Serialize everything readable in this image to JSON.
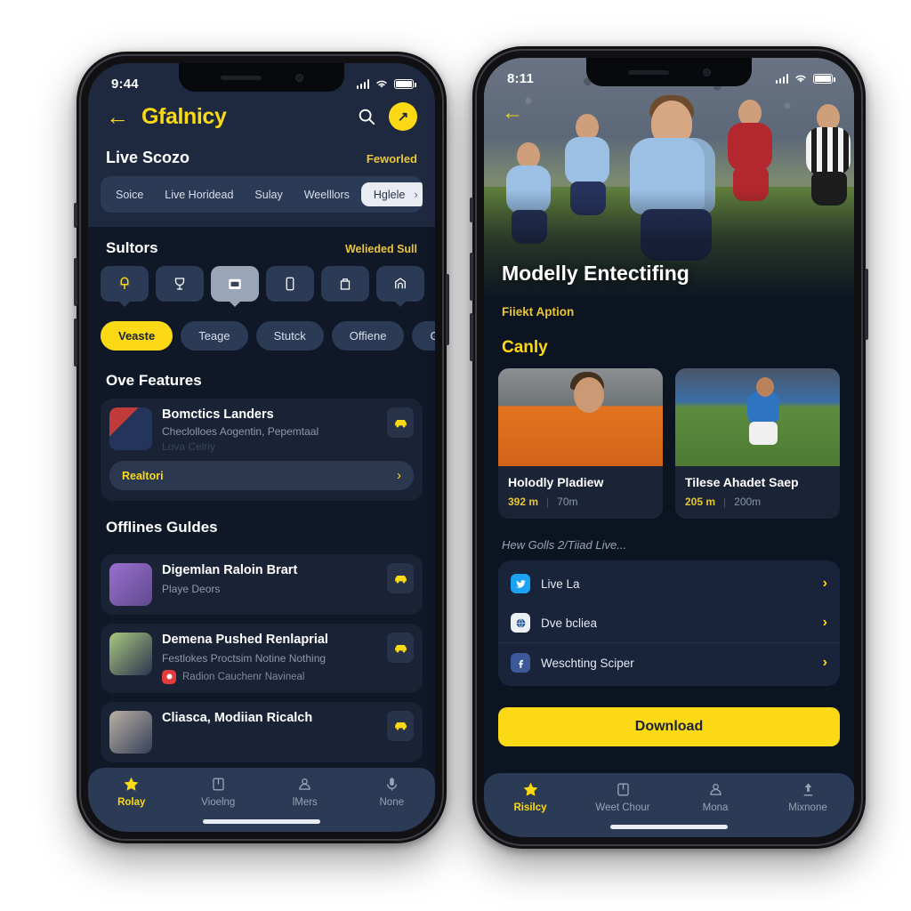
{
  "left_phone": {
    "status_bar": {
      "time": "9:44",
      "signal_icon": "cellular-bars-icon",
      "wifi_icon": "wifi-icon",
      "battery_icon": "battery-icon"
    },
    "header": {
      "back_icon": "back-arrow-icon",
      "brand": "Gfalnicy",
      "search_icon": "search-icon",
      "avatar_label": "↗"
    },
    "subhead": {
      "title": "Live Scozo",
      "action": "Feworled"
    },
    "tabs": [
      {
        "label": "Soice",
        "active": false
      },
      {
        "label": "Live Horidead",
        "active": false
      },
      {
        "label": "Sulay",
        "active": false
      },
      {
        "label": "Weelllors",
        "active": false
      },
      {
        "label": "Hglele",
        "active": true,
        "chevron": "›"
      }
    ],
    "sports_section": {
      "title": "Sultors",
      "action": "Welieded Sull",
      "icons": [
        {
          "name": "bell-icon",
          "active": true,
          "light": false,
          "pointer": true
        },
        {
          "name": "trophy-icon",
          "active": false,
          "light": false,
          "pointer": false
        },
        {
          "name": "calendar-icon",
          "active": true,
          "light": true,
          "pointer": true
        },
        {
          "name": "phone-icon",
          "active": false,
          "light": false,
          "pointer": false
        },
        {
          "name": "bag-icon",
          "active": false,
          "light": false,
          "pointer": false
        },
        {
          "name": "arch-icon",
          "active": false,
          "light": false,
          "pointer": true
        }
      ]
    },
    "chips": [
      {
        "label": "Veaste",
        "active": true
      },
      {
        "label": "Teage",
        "active": false
      },
      {
        "label": "Stutck",
        "active": false
      },
      {
        "label": "Offiene",
        "active": false
      },
      {
        "label": "Giane",
        "active": false
      }
    ],
    "features": {
      "title": "Ove Features",
      "card": {
        "name": "Bomctics Landers",
        "sub": "Checlolloes Aogentin, Pepemtaal",
        "sub2": "Lova Celriy",
        "badge_icon": "car-icon",
        "pill_label": "Realtori",
        "pill_chevron": "›"
      }
    },
    "guides": {
      "title": "Offlines Guldes",
      "items": [
        {
          "name": "Digemlan Raloin Brart",
          "sub": "Playe Deors",
          "meta": "",
          "has_meta_icon": false,
          "badge_icon": "car-icon"
        },
        {
          "name": "Demena Pushed Renlaprial",
          "sub": "Festlokes Proctsim Notine Nothing",
          "meta": "Radion Cauchenr Navineal",
          "has_meta_icon": true,
          "badge_icon": "car-icon"
        },
        {
          "name": "Cliasca, Modiian Ricalch",
          "sub": "",
          "meta": "",
          "has_meta_icon": false,
          "badge_icon": "car-icon"
        }
      ]
    },
    "bottom_nav": [
      {
        "label": "Rolay",
        "icon": "star-icon",
        "active": true
      },
      {
        "label": "Vioelng",
        "icon": "book-icon",
        "active": false
      },
      {
        "label": "lMers",
        "icon": "person-icon",
        "active": false
      },
      {
        "label": "None",
        "icon": "mic-icon",
        "active": false
      }
    ]
  },
  "right_phone": {
    "status_bar": {
      "time": "8:11",
      "signal_icon": "cellular-bars-icon",
      "wifi_icon": "wifi-icon",
      "battery_icon": "battery-icon"
    },
    "hero": {
      "back_icon": "back-arrow-icon",
      "title": "Modelly Entectifing",
      "image_alt": "soccer-match-photo"
    },
    "subtitle": "Fiiekt Aption",
    "section_title": "Canly",
    "match_cards": [
      {
        "title": "Holodly Pladiew",
        "stat1": "392 m",
        "divider": "|",
        "stat2": "70m",
        "image_alt": "orange-kit-player-photo"
      },
      {
        "title": "Tilese Ahadet Saep",
        "stat1": "205 m",
        "divider": "|",
        "stat2": "200m",
        "image_alt": "blue-kit-player-photo"
      }
    ],
    "note": "Hew Golls 2/Tiiad Live...",
    "links": [
      {
        "label": "Live La",
        "icon": "twitter-icon",
        "chevron": "›",
        "separator": false
      },
      {
        "label": "Dve bcliea",
        "icon": "globe-icon",
        "chevron": "›",
        "separator": false
      },
      {
        "label": "Weschting Sciper",
        "icon": "facebook-icon",
        "chevron": "›",
        "separator": true
      }
    ],
    "download_button": "Download",
    "bottom_nav": [
      {
        "label": "Risilcy",
        "icon": "star-icon",
        "active": true
      },
      {
        "label": "Weet Chour",
        "icon": "book-icon",
        "active": false
      },
      {
        "label": "Mona",
        "icon": "person-icon",
        "active": false
      },
      {
        "label": "Mixnone",
        "icon": "upload-icon",
        "active": false
      }
    ]
  },
  "colors": {
    "accent_yellow": "#fbd914",
    "header_navy": "#1e293f",
    "body_navy": "#101828",
    "card_navy": "#1a2335",
    "right_bg": "#0d1421"
  }
}
